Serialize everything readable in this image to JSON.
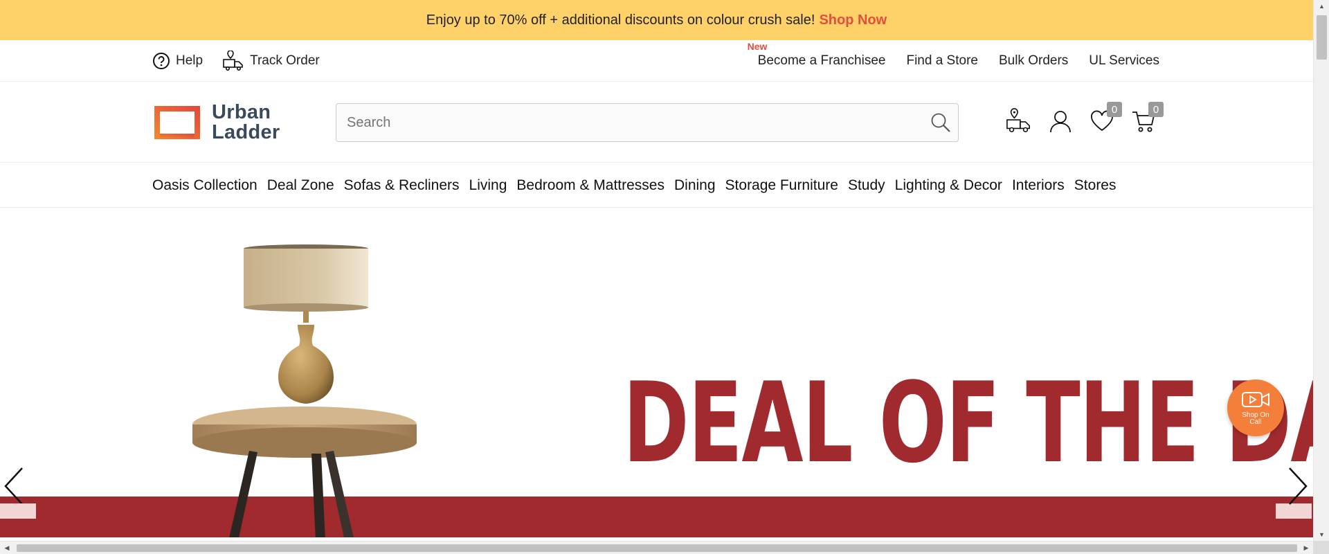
{
  "promo": {
    "text": "Enjoy up to 70% off + additional discounts on colour crush sale!",
    "cta": "Shop Now",
    "background": "#ffd169",
    "cta_color": "#e24f3d"
  },
  "utility": {
    "left": [
      {
        "label": "Help",
        "icon": "help-circle-icon"
      },
      {
        "label": "Track Order",
        "icon": "delivery-truck-icon"
      }
    ],
    "right": [
      {
        "label": "Become a Franchisee",
        "tag": "New"
      },
      {
        "label": "Find a Store"
      },
      {
        "label": "Bulk Orders"
      },
      {
        "label": "UL Services"
      }
    ]
  },
  "header": {
    "logo_line1": "Urban",
    "logo_line2": "Ladder",
    "search_placeholder": "Search",
    "wishlist_count": "0",
    "cart_count": "0",
    "icons": [
      "store-locator-truck-icon",
      "user-profile-icon",
      "heart-wishlist-icon",
      "cart-icon"
    ]
  },
  "nav": {
    "items": [
      "Oasis Collection",
      "Deal Zone",
      "Sofas & Recliners",
      "Living",
      "Bedroom & Mattresses",
      "Dining",
      "Storage Furniture",
      "Study",
      "Lighting & Decor",
      "Interiors",
      "Stores"
    ]
  },
  "hero": {
    "headline": "DEAL OF THE DAY",
    "accent_color": "#a12a2f"
  },
  "shop_on_call": {
    "label": "Shop On Call",
    "color": "#f47f3a"
  }
}
